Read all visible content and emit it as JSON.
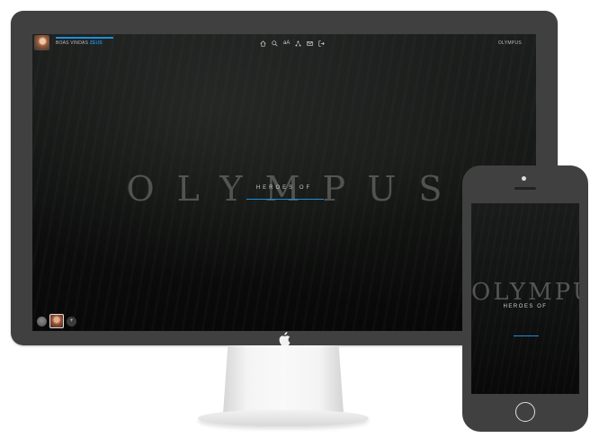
{
  "desktop": {
    "welcome_prefix": "BOAS VINDAS",
    "welcome_user": "ZEUS",
    "brand_top": "OLYMPUS",
    "nav_icons": [
      "home-icon",
      "search-icon",
      "font-size-icon",
      "share-icon",
      "mail-icon",
      "logout-icon"
    ],
    "font_size_label": "aA",
    "hero": {
      "title": "OLYMPUS",
      "overlay": "HEROES OF"
    },
    "chat_more": "+"
  },
  "phone": {
    "hero": {
      "title": "OLYMPUS",
      "overlay": "HEROES OF"
    }
  },
  "colors": {
    "accent": "#1b8fdc",
    "device_frame": "#404040",
    "screen_bg": "#0c0d0c"
  }
}
